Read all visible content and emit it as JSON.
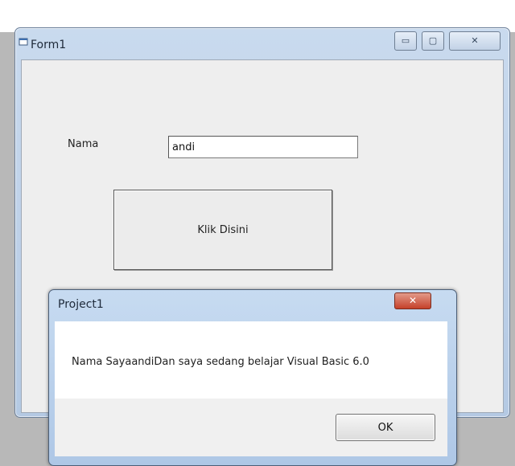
{
  "form_window": {
    "title": "Form1",
    "minimize_glyph": "▭",
    "maximize_glyph": "▢",
    "close_glyph": "✕"
  },
  "form": {
    "name_label": "Nama",
    "name_value": "andi",
    "button_label": "Klik Disini"
  },
  "dialog": {
    "title": "Project1",
    "close_glyph": "✕",
    "message": "Nama SayaandiDan saya sedang belajar Visual Basic 6.0",
    "ok_label": "OK"
  },
  "colors": {
    "window_frame": "#c9daee",
    "client_bg": "#eeeeee",
    "close_red": "#c5412a"
  }
}
